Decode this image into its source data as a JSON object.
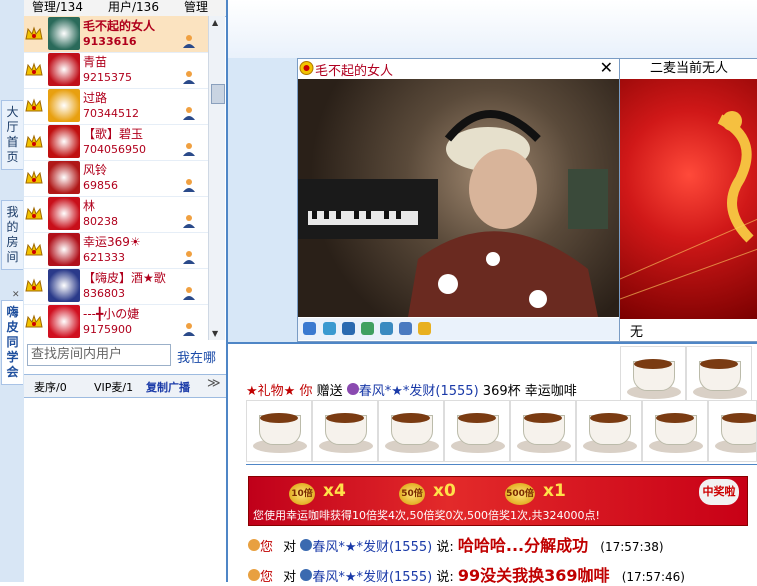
{
  "left_tabs": [
    {
      "label": "大厅首页"
    },
    {
      "label": "我的房间"
    },
    {
      "label": "嗨皮同学会"
    }
  ],
  "user_panel": {
    "tabs": [
      "管理/134",
      "用户/136",
      "管理"
    ],
    "users": [
      {
        "name": "毛不起的女人",
        "id": "9133616",
        "selected": true
      },
      {
        "name": "青苗",
        "id": "9215375"
      },
      {
        "name": "过路",
        "id": "70344512"
      },
      {
        "name": "【歌】碧玉",
        "id": "704056950"
      },
      {
        "name": "风铃",
        "id": "69856"
      },
      {
        "name": "林",
        "id": "80238"
      },
      {
        "name": "幸运369☀",
        "id": "621333"
      },
      {
        "name": "【嗨皮】酒★歌",
        "id": "836803"
      },
      {
        "name": "---╋小の婕",
        "id": "9175900"
      }
    ],
    "search_placeholder": "查找房间内用户",
    "find_button": "我在哪",
    "mic_tabs": [
      "麦序/0",
      "VIP麦/1",
      "复制广播"
    ]
  },
  "video": {
    "mic1_name": "毛不起的女人",
    "mic2_title": "二麦当前无人",
    "mic2_footer": "无"
  },
  "chat": {
    "gift_prefix": "★礼物★",
    "gift_you": "你",
    "gift_verb": "赠送",
    "gift_target": "春风*★*发财",
    "gift_target_id": "(1555)",
    "gift_count": "369杯",
    "gift_item": "幸运咖啡",
    "banner": {
      "mult_10": "x4",
      "mult_50": "x0",
      "mult_500": "x1",
      "coin_10": "10倍",
      "coin_50": "50倍",
      "coin_500": "500倍",
      "text": "您使用幸运咖啡获得10倍奖4次,50倍奖0次,500倍奖1次,共324000点!",
      "badge": "中奖啦"
    },
    "messages": [
      {
        "from": "您",
        "to_word": "对",
        "target": "春风*★*发财",
        "target_id": "(1555)",
        "say": "说:",
        "text": "哈哈哈...分解成功",
        "time": "(17:57:38)"
      },
      {
        "from": "您",
        "to_word": "对",
        "target": "春风*★*发财",
        "target_id": "(1555)",
        "say": "说:",
        "text": "99没关我换369咖啡",
        "time": "(17:57:46)"
      }
    ]
  },
  "colors": {
    "accent": "#4f86c6",
    "name_red": "#b0001c",
    "panel_blue": "#d7e7f7"
  }
}
